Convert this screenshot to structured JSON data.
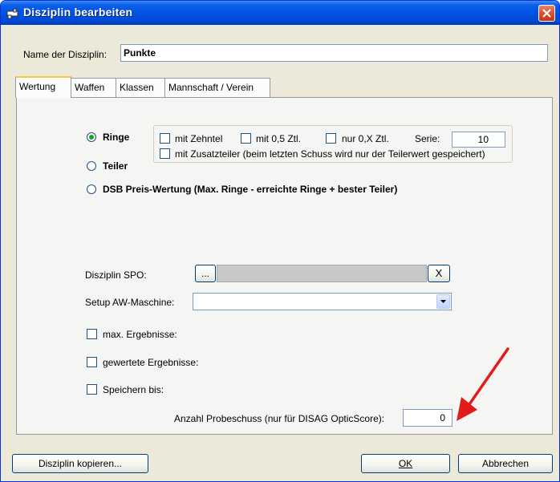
{
  "window": {
    "title": "Disziplin bearbeiten"
  },
  "name": {
    "label": "Name der Disziplin:",
    "value": "Punkte"
  },
  "tabs": [
    {
      "label": "Wertung"
    },
    {
      "label": "Waffen"
    },
    {
      "label": "Klassen"
    },
    {
      "label": "Mannschaft / Verein"
    }
  ],
  "wertung": {
    "radio_ringe": "Ringe",
    "radio_teiler": "Teiler",
    "radio_dsb": "DSB Preis-Wertung (Max. Ringe - erreichte Ringe + bester Teiler)",
    "cb_zehntel": "mit Zehntel",
    "cb_05": "mit 0,5 Ztl.",
    "cb_0x": "nur 0,X Ztl.",
    "serie_label": "Serie:",
    "serie_value": "10",
    "cb_zusatzteiler": "mit Zusatzteiler (beim letzten Schuss wird nur der Teilerwert gespeichert)"
  },
  "spo": {
    "label": "Disziplin SPO:",
    "browse": "...",
    "clear": "X"
  },
  "setup": {
    "label": "Setup AW-Maschine:",
    "value": ""
  },
  "checks": {
    "max": "max. Ergebnisse:",
    "gewertete": "gewertete Ergebnisse:",
    "speichern": "Speichern bis:"
  },
  "probeschuss": {
    "label": "Anzahl Probeschuss (nur für DISAG OpticScore):",
    "value": "0"
  },
  "buttons": {
    "copy": "Disziplin kopieren...",
    "ok": "OK",
    "cancel": "Abbrechen"
  },
  "colors": {
    "arrow": "#e21b1b",
    "title_bar": "#0054e3"
  }
}
